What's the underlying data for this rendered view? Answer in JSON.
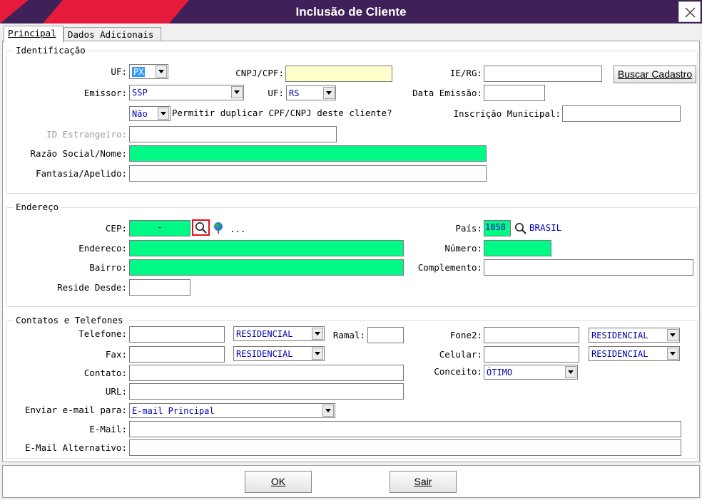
{
  "window": {
    "title": "Inclusão de Cliente"
  },
  "tabs": [
    "Principal",
    "Dados Adicionais"
  ],
  "identificacao": {
    "legend": "Identificação",
    "uf_label": "UF:",
    "uf_value": "PX",
    "cnpj_label": "CNPJ/CPF:",
    "cnpj_value": "",
    "ierg_label": "IE/RG:",
    "ierg_value": "",
    "buscar_label": "Buscar Cadastro",
    "emissor_label": "Emissor:",
    "emissor_value": "SSP",
    "uf2_label": "UF:",
    "uf2_value": "RS",
    "data_emissao_label": "Data Emissão:",
    "data_emissao_value": "",
    "duplicar_value": "Não",
    "duplicar_label": "Permitir duplicar CPF/CNPJ deste cliente?",
    "inscricao_label": "Inscrição Municipal:",
    "inscricao_value": "",
    "id_estrangeiro_label": "ID Estrangeiro:",
    "id_estrangeiro_value": "",
    "razao_label": "Razão Social/Nome:",
    "razao_value": "",
    "fantasia_label": "Fantasia/Apelido:",
    "fantasia_value": ""
  },
  "endereco": {
    "legend": "Endereço",
    "cep_label": "CEP:",
    "cep_value": "-",
    "ellipsis": "...",
    "pais_label": "País:",
    "pais_code": "1058",
    "pais_name": "BRASIL",
    "endereco_label": "Endereco:",
    "endereco_value": "",
    "numero_label": "Número:",
    "numero_value": "",
    "bairro_label": "Bairro:",
    "bairro_value": "",
    "complemento_label": "Complemento:",
    "complemento_value": "",
    "reside_label": "Reside Desde:",
    "reside_value": ""
  },
  "contatos": {
    "legend": "Contatos e Telefones",
    "telefone_label": "Telefone:",
    "telefone_value": "",
    "telefone_tipo": "RESIDENCIAL",
    "ramal_label": "Ramal:",
    "ramal_value": "",
    "fone2_label": "Fone2:",
    "fone2_value": "",
    "fone2_tipo": "RESIDENCIAL",
    "fax_label": "Fax:",
    "fax_value": "",
    "fax_tipo": "RESIDENCIAL",
    "celular_label": "Celular:",
    "celular_value": "",
    "celular_tipo": "RESIDENCIAL",
    "contato_label": "Contato:",
    "contato_value": "",
    "conceito_label": "Conceito:",
    "conceito_value": "ÓTIMO",
    "url_label": "URL:",
    "url_value": "",
    "enviar_label": "Enviar e-mail para:",
    "enviar_value": "E-mail Principal",
    "email_label": "E-Mail:",
    "email_value": "",
    "email_alt_label": "E-Mail Alternativo:",
    "email_alt_value": ""
  },
  "footer": {
    "ok_label": "OK",
    "sair_label": "Sair"
  },
  "colors": {
    "title_bg": "#3f2059",
    "title_accent": "#e61b3b",
    "required_field": "#00fa85",
    "cnpj_field": "#ffffcc",
    "combo_text": "#0000b0"
  },
  "icons": {
    "close": "close-icon",
    "search": "magnifier-icon",
    "map": "map-pin-icon"
  }
}
